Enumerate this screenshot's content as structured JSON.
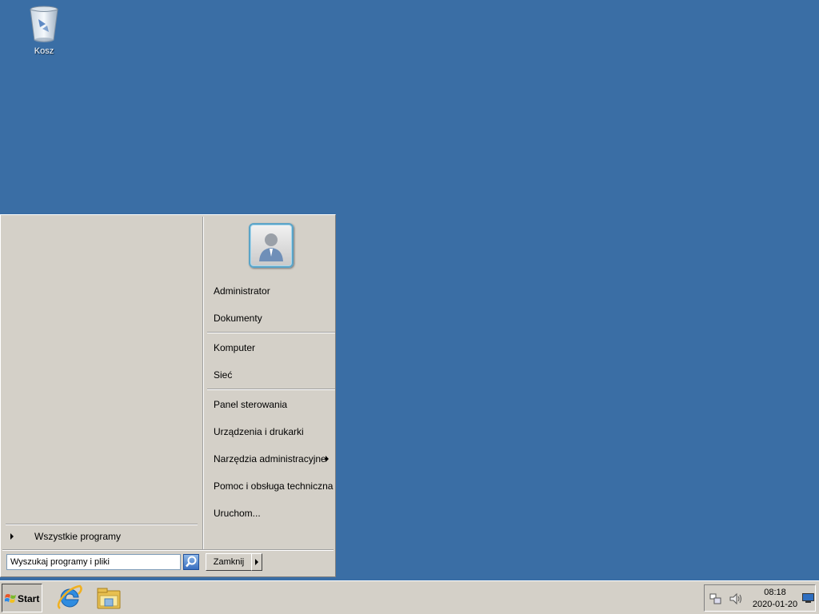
{
  "desktop": {
    "background_color": "#3a6ea5",
    "icons": [
      {
        "label": "Kosz",
        "icon": "recycle-bin-icon"
      }
    ]
  },
  "start_menu": {
    "user_picture": "user-avatar-icon",
    "all_programs_label": "Wszystkie programy",
    "search": {
      "value": "",
      "placeholder": "Wyszukaj programy i pliki"
    },
    "shutdown_label": "Zamknij",
    "right_items": [
      {
        "label": "Administrator"
      },
      {
        "label": "Dokumenty"
      },
      {
        "label": "Komputer"
      },
      {
        "label": "Sieć"
      },
      {
        "label": "Panel sterowania"
      },
      {
        "label": "Urządzenia i drukarki"
      },
      {
        "label": "Narzędzia administracyjne",
        "submenu": true
      },
      {
        "label": "Pomoc i obsługa techniczna"
      },
      {
        "label": "Uruchom..."
      }
    ]
  },
  "taskbar": {
    "start_label": "Start",
    "pinned": [
      "internet-explorer-icon",
      "windows-explorer-icon"
    ],
    "tray": {
      "time": "08:18",
      "date": "2020-01-20",
      "icons": [
        "network-icon",
        "volume-icon",
        "show-desktop-icon"
      ]
    }
  }
}
